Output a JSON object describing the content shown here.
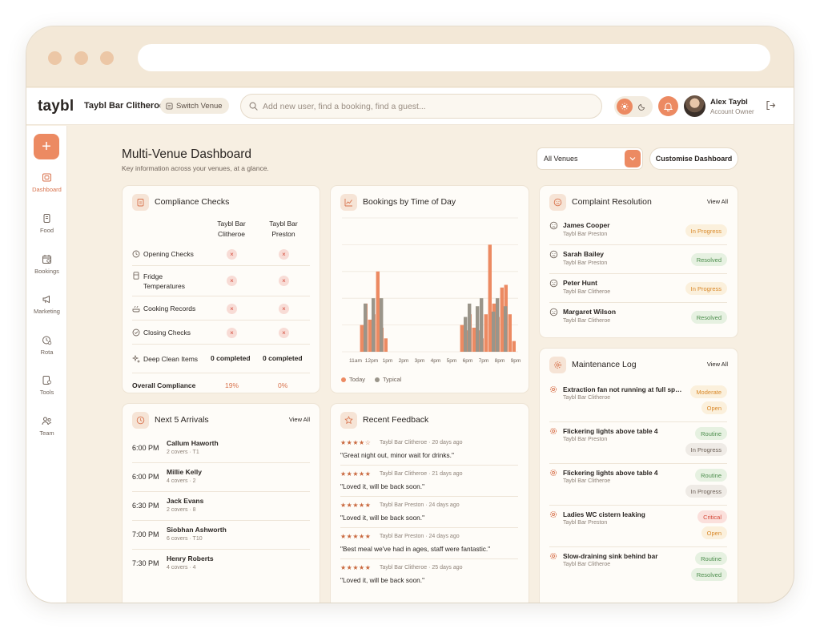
{
  "app": {
    "logo": "taybl",
    "venue_name": "Taybl Bar Clitheroe",
    "switch_venue": "Switch Venue",
    "search_placeholder": "Add new user, find a booking, find a guest...",
    "user": {
      "name": "Alex Taybl",
      "role": "Account Owner"
    }
  },
  "colors": {
    "accent": "#ec8a62",
    "background": "#f7efe2",
    "today": "#ec8a62",
    "typical": "#9a958a"
  },
  "sidebar": {
    "items": [
      {
        "label": "Dashboard",
        "icon": "dashboard-icon",
        "active": true
      },
      {
        "label": "Food",
        "icon": "food-icon"
      },
      {
        "label": "Bookings",
        "icon": "bookings-icon"
      },
      {
        "label": "Marketing",
        "icon": "megaphone-icon"
      },
      {
        "label": "Rota",
        "icon": "rota-icon"
      },
      {
        "label": "Tools",
        "icon": "tools-icon"
      },
      {
        "label": "Team",
        "icon": "team-icon"
      }
    ]
  },
  "header": {
    "title": "Multi-Venue Dashboard",
    "subtitle": "Key information across your venues, at a glance.",
    "venue_select": "All Venues",
    "customise": "Customise Dashboard"
  },
  "compliance": {
    "title": "Compliance Checks",
    "col1": [
      "Taybl Bar",
      "Clitheroe"
    ],
    "col2": [
      "Taybl Bar",
      "Preston"
    ],
    "rows": [
      {
        "label": [
          "Opening Checks"
        ],
        "status": [
          "×",
          "×"
        ]
      },
      {
        "label": [
          "Fridge",
          "Temperatures"
        ],
        "status": [
          "×",
          "×"
        ]
      },
      {
        "label": [
          "Cooking Records"
        ],
        "status": [
          "×",
          "×"
        ]
      },
      {
        "label": [
          "Closing Checks"
        ],
        "status": [
          "×",
          "×"
        ]
      }
    ],
    "deep_clean": {
      "label": "Deep Clean Items",
      "values": [
        "0 completed",
        "0 completed"
      ]
    },
    "overall": {
      "label": "Overall Compliance",
      "values": [
        "19%",
        "0%"
      ]
    }
  },
  "bookings_chart": {
    "title": "Bookings by Time of Day",
    "legend": [
      "Today",
      "Typical"
    ]
  },
  "chart_data": {
    "type": "bar",
    "title": "Bookings by Time of Day",
    "categories": [
      "11am",
      "12pm",
      "1pm",
      "2pm",
      "3pm",
      "4pm",
      "5pm",
      "6pm",
      "7pm",
      "8pm",
      "9pm"
    ],
    "x": [
      11,
      11.25,
      11.5,
      11.75,
      12,
      12.25,
      12.5,
      12.75,
      13,
      13.25,
      13.5,
      13.75,
      17.5,
      17.75,
      18,
      18.25,
      18.5,
      18.75,
      19,
      19.25,
      19.5,
      19.75,
      20,
      20.25,
      20.5,
      20.75,
      21
    ],
    "series": [
      {
        "name": "Today",
        "values": [
          0,
          0,
          2.0,
          3.6,
          2.4,
          2.8,
          6.0,
          1.8,
          1.0,
          0,
          0,
          0,
          0,
          2.0,
          1.6,
          2.8,
          1.8,
          1.6,
          1.0,
          2.8,
          8.0,
          3.6,
          2.6,
          4.8,
          5.0,
          2.8,
          0.8
        ]
      },
      {
        "name": "Typical",
        "values": [
          0,
          0,
          3.6,
          0,
          4.0,
          0,
          4.0,
          0,
          0,
          0,
          0,
          0,
          0,
          2.6,
          3.6,
          0,
          3.4,
          4.0,
          0,
          0,
          3.0,
          4.0,
          0,
          3.4,
          0,
          0,
          0
        ]
      }
    ],
    "ylim": [
      0,
      10
    ],
    "grid": true,
    "legend": "bottom-left"
  },
  "complaints": {
    "title": "Complaint Resolution",
    "view_all": "View All",
    "items": [
      {
        "name": "James Cooper",
        "venue": "Taybl Bar Preston",
        "status": "In Progress"
      },
      {
        "name": "Sarah Bailey",
        "venue": "Taybl Bar Preston",
        "status": "Resolved"
      },
      {
        "name": "Peter Hunt",
        "venue": "Taybl Bar Clitheroe",
        "status": "In Progress"
      },
      {
        "name": "Margaret Wilson",
        "venue": "Taybl Bar Clitheroe",
        "status": "Resolved"
      }
    ]
  },
  "maintenance": {
    "title": "Maintenance Log",
    "view_all": "View All",
    "items": [
      {
        "title": "Extraction fan not running at full speed",
        "venue": "Taybl Bar Clitheroe",
        "priority": "Moderate",
        "status": "Open"
      },
      {
        "title": "Flickering lights above table 4",
        "venue": "Taybl Bar Preston",
        "priority": "Routine",
        "status": "In Progress"
      },
      {
        "title": "Flickering lights above table 4",
        "venue": "Taybl Bar Clitheroe",
        "priority": "Routine",
        "status": "In Progress"
      },
      {
        "title": "Ladies WC cistern leaking",
        "venue": "Taybl Bar Preston",
        "priority": "Critical",
        "status": "Open"
      },
      {
        "title": "Slow-draining sink behind bar",
        "venue": "Taybl Bar Clitheroe",
        "priority": "Routine",
        "status": "Resolved"
      }
    ]
  },
  "arrivals": {
    "title": "Next 5 Arrivals",
    "view_all": "View All",
    "items": [
      {
        "time": "6:00 PM",
        "name": "Callum Haworth",
        "meta": "2 covers · T1"
      },
      {
        "time": "6:00 PM",
        "name": "Millie Kelly",
        "meta": "4 covers · 2"
      },
      {
        "time": "6:30 PM",
        "name": "Jack Evans",
        "meta": "2 covers · 8"
      },
      {
        "time": "7:00 PM",
        "name": "Siobhan Ashworth",
        "meta": "6 covers · T10"
      },
      {
        "time": "7:30 PM",
        "name": "Henry Roberts",
        "meta": "4 covers · 4"
      }
    ]
  },
  "feedback": {
    "title": "Recent Feedback",
    "items": [
      {
        "stars": "★★★★☆",
        "rating": 4,
        "source": "Taybl Bar Clitheroe · 20 days ago",
        "quote": "\"Great night out, minor wait for drinks.\""
      },
      {
        "stars": "★★★★★",
        "rating": 5,
        "source": "Taybl Bar Clitheroe · 21 days ago",
        "quote": "\"Loved it, will be back soon.\""
      },
      {
        "stars": "★★★★★",
        "rating": 5,
        "source": "Taybl Bar Preston · 24 days ago",
        "quote": "\"Loved it, will be back soon.\""
      },
      {
        "stars": "★★★★★",
        "rating": 5,
        "source": "Taybl Bar Preston · 24 days ago",
        "quote": "\"Best meal we've had in ages, staff were fantastic.\""
      },
      {
        "stars": "★★★★★",
        "rating": 5,
        "source": "Taybl Bar Clitheroe · 25 days ago",
        "quote": "\"Loved it, will be back soon.\""
      }
    ]
  }
}
